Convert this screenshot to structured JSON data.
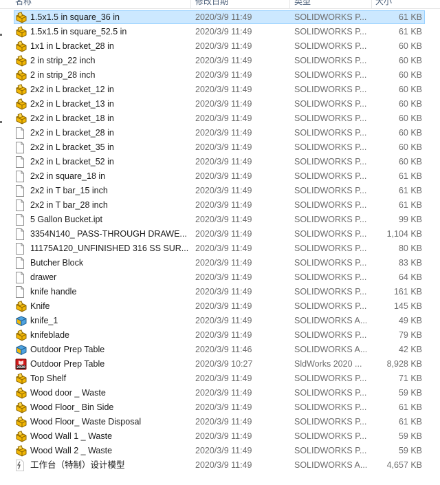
{
  "header": {
    "col_name": "名称",
    "col_date": "修改日期",
    "col_type": "类型",
    "col_size": "大小"
  },
  "colors": {
    "selection_bg": "#cce8ff",
    "selection_border": "#99d1ff",
    "part_icon": "#f0b400",
    "text_muted": "#6d6d6d"
  },
  "files": [
    {
      "name": "1.5x1.5 in square_36 in",
      "date": "2020/3/9 11:49",
      "type": "SOLIDWORKS P...",
      "size": "61 KB",
      "icon": "sw-part-icon",
      "selected": true
    },
    {
      "name": "1.5x1.5 in square_52.5 in",
      "date": "2020/3/9 11:49",
      "type": "SOLIDWORKS P...",
      "size": "61 KB",
      "icon": "sw-part-icon"
    },
    {
      "name": "1x1 in L bracket_28 in",
      "date": "2020/3/9 11:49",
      "type": "SOLIDWORKS P...",
      "size": "60 KB",
      "icon": "sw-part-icon"
    },
    {
      "name": "2 in strip_22 inch",
      "date": "2020/3/9 11:49",
      "type": "SOLIDWORKS P...",
      "size": "60 KB",
      "icon": "sw-part-icon"
    },
    {
      "name": "2 in strip_28 inch",
      "date": "2020/3/9 11:49",
      "type": "SOLIDWORKS P...",
      "size": "60 KB",
      "icon": "sw-part-icon"
    },
    {
      "name": "2x2 in L bracket_12 in",
      "date": "2020/3/9 11:49",
      "type": "SOLIDWORKS P...",
      "size": "60 KB",
      "icon": "sw-part-icon"
    },
    {
      "name": "2x2 in L bracket_13 in",
      "date": "2020/3/9 11:49",
      "type": "SOLIDWORKS P...",
      "size": "60 KB",
      "icon": "sw-part-icon"
    },
    {
      "name": "2x2 in L bracket_18 in",
      "date": "2020/3/9 11:49",
      "type": "SOLIDWORKS P...",
      "size": "60 KB",
      "icon": "sw-part-icon"
    },
    {
      "name": "2x2 in L bracket_28 in",
      "date": "2020/3/9 11:49",
      "type": "SOLIDWORKS P...",
      "size": "60 KB",
      "icon": "blank-file-icon"
    },
    {
      "name": "2x2 in L bracket_35 in",
      "date": "2020/3/9 11:49",
      "type": "SOLIDWORKS P...",
      "size": "60 KB",
      "icon": "blank-file-icon"
    },
    {
      "name": "2x2 in L bracket_52 in",
      "date": "2020/3/9 11:49",
      "type": "SOLIDWORKS P...",
      "size": "60 KB",
      "icon": "blank-file-icon"
    },
    {
      "name": "2x2 in square_18 in",
      "date": "2020/3/9 11:49",
      "type": "SOLIDWORKS P...",
      "size": "61 KB",
      "icon": "blank-file-icon"
    },
    {
      "name": "2x2 in T bar_15 inch",
      "date": "2020/3/9 11:49",
      "type": "SOLIDWORKS P...",
      "size": "61 KB",
      "icon": "blank-file-icon"
    },
    {
      "name": "2x2 in T bar_28 inch",
      "date": "2020/3/9 11:49",
      "type": "SOLIDWORKS P...",
      "size": "61 KB",
      "icon": "blank-file-icon"
    },
    {
      "name": "5 Gallon Bucket.ipt",
      "date": "2020/3/9 11:49",
      "type": "SOLIDWORKS P...",
      "size": "99 KB",
      "icon": "blank-file-icon"
    },
    {
      "name": "3354N140_ PASS-THROUGH DRAWE...",
      "date": "2020/3/9 11:49",
      "type": "SOLIDWORKS P...",
      "size": "1,104 KB",
      "icon": "blank-file-icon"
    },
    {
      "name": "11175A120_UNFINISHED 316 SS SUR...",
      "date": "2020/3/9 11:49",
      "type": "SOLIDWORKS P...",
      "size": "80 KB",
      "icon": "blank-file-icon"
    },
    {
      "name": "Butcher Block",
      "date": "2020/3/9 11:49",
      "type": "SOLIDWORKS P...",
      "size": "83 KB",
      "icon": "blank-file-icon"
    },
    {
      "name": "drawer",
      "date": "2020/3/9 11:49",
      "type": "SOLIDWORKS P...",
      "size": "64 KB",
      "icon": "blank-file-icon"
    },
    {
      "name": "knife handle",
      "date": "2020/3/9 11:49",
      "type": "SOLIDWORKS P...",
      "size": "161 KB",
      "icon": "blank-file-icon"
    },
    {
      "name": "Knife",
      "date": "2020/3/9 11:49",
      "type": "SOLIDWORKS P...",
      "size": "145 KB",
      "icon": "sw-part-icon"
    },
    {
      "name": "knife_1",
      "date": "2020/3/9 11:49",
      "type": "SOLIDWORKS A...",
      "size": "49 KB",
      "icon": "sw-assembly-icon"
    },
    {
      "name": "knifeblade",
      "date": "2020/3/9 11:49",
      "type": "SOLIDWORKS P...",
      "size": "79 KB",
      "icon": "sw-part-icon"
    },
    {
      "name": "Outdoor Prep Table",
      "date": "2020/3/9 11:46",
      "type": "SOLIDWORKS A...",
      "size": "42 KB",
      "icon": "sw-assembly-icon"
    },
    {
      "name": "Outdoor Prep Table",
      "date": "2020/3/9 10:27",
      "type": "SldWorks 2020 ...",
      "size": "8,928 KB",
      "icon": "sldworks-2020-icon",
      "icon_label": "2020"
    },
    {
      "name": "Top Shelf",
      "date": "2020/3/9 11:49",
      "type": "SOLIDWORKS P...",
      "size": "71 KB",
      "icon": "sw-part-icon"
    },
    {
      "name": "Wood door _ Waste",
      "date": "2020/3/9 11:49",
      "type": "SOLIDWORKS P...",
      "size": "59 KB",
      "icon": "sw-part-icon"
    },
    {
      "name": "Wood Floor_ Bin Side",
      "date": "2020/3/9 11:49",
      "type": "SOLIDWORKS P...",
      "size": "61 KB",
      "icon": "sw-part-icon"
    },
    {
      "name": "Wood Floor_ Waste Disposal",
      "date": "2020/3/9 11:49",
      "type": "SOLIDWORKS P...",
      "size": "61 KB",
      "icon": "sw-part-icon"
    },
    {
      "name": "Wood Wall 1 _ Waste",
      "date": "2020/3/9 11:49",
      "type": "SOLIDWORKS P...",
      "size": "59 KB",
      "icon": "sw-part-icon"
    },
    {
      "name": "Wood Wall 2 _ Waste",
      "date": "2020/3/9 11:49",
      "type": "SOLIDWORKS P...",
      "size": "59 KB",
      "icon": "sw-part-icon"
    },
    {
      "name": "工作台（特制）设计模型",
      "date": "2020/3/9 11:49",
      "type": "SOLIDWORKS A...",
      "size": "4,657 KB",
      "icon": "assembly-shortcut-icon"
    }
  ]
}
